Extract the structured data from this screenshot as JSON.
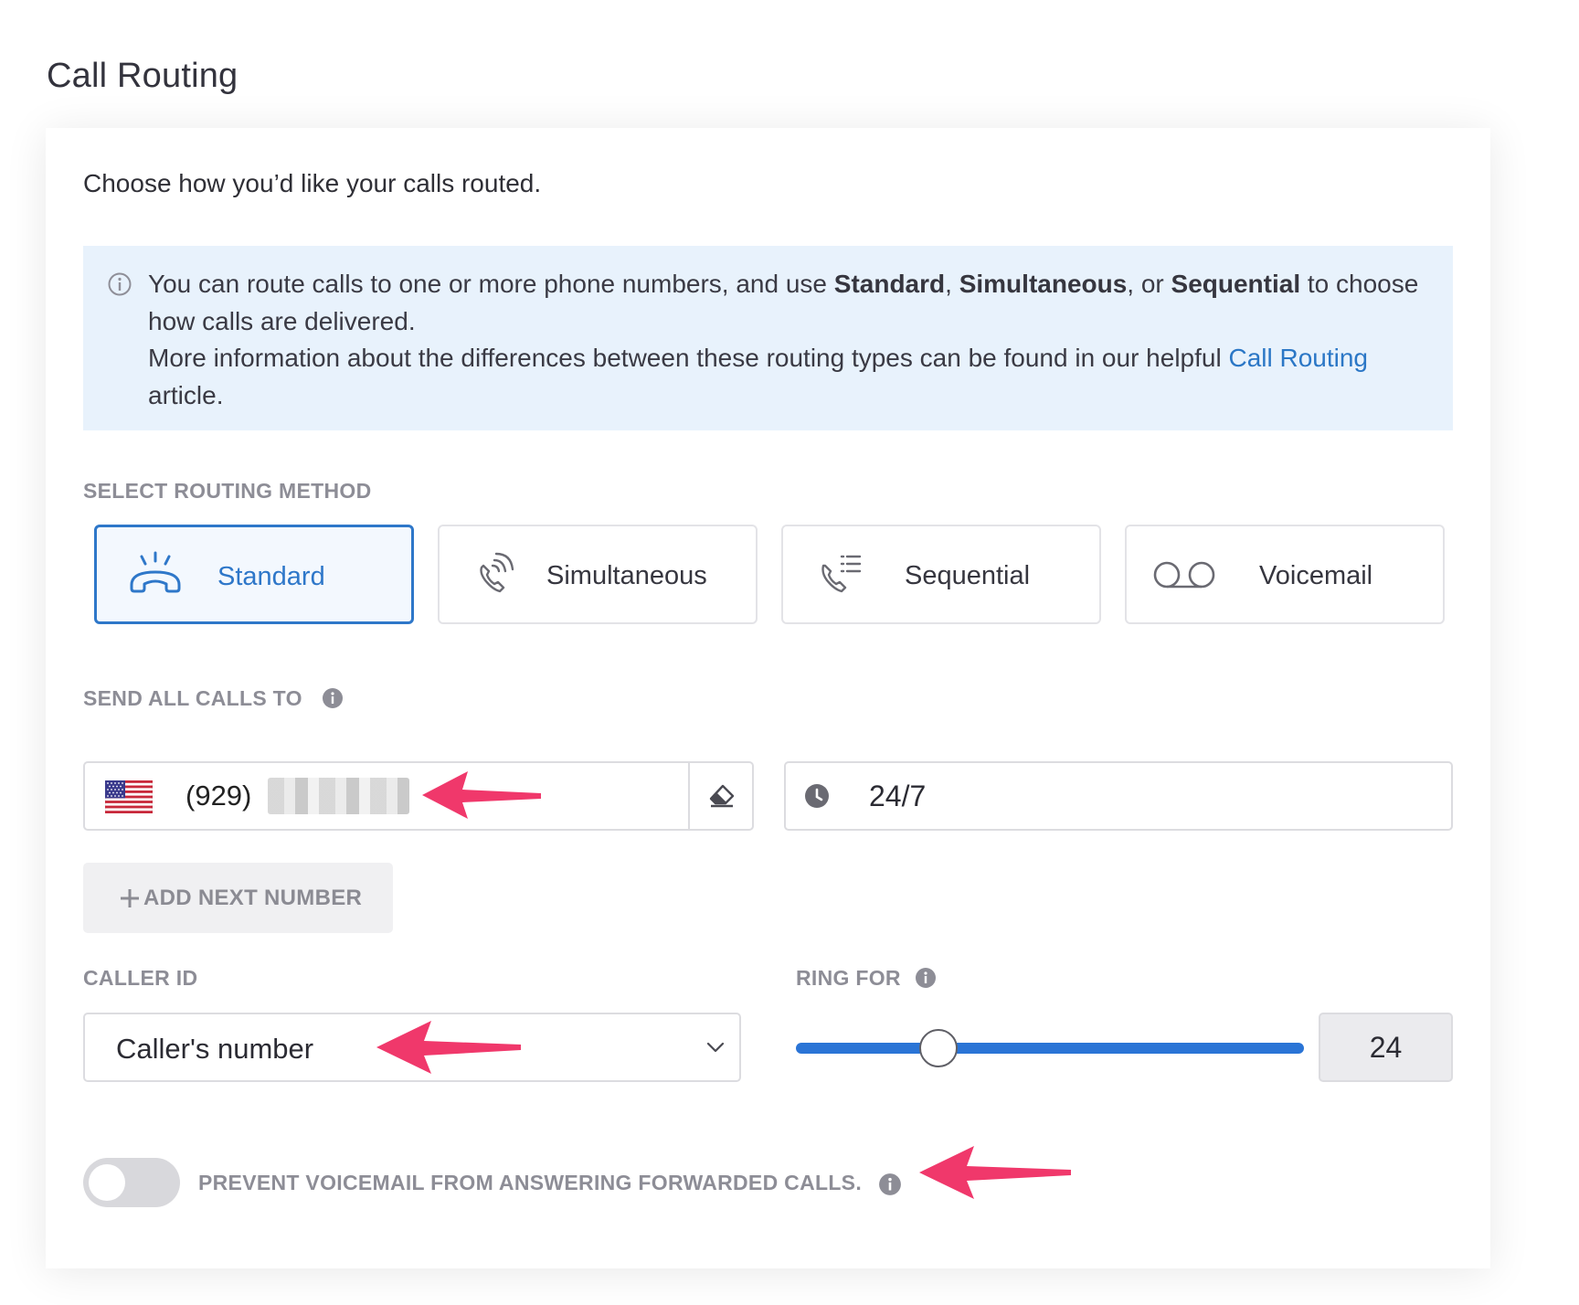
{
  "page": {
    "title": "Call Routing"
  },
  "card": {
    "intro": "Choose how you’d like your calls routed.",
    "info": {
      "line1_prefix": "You can route calls to one or more phone numbers, and use ",
      "standard": "Standard",
      "comma1": ", ",
      "simultaneous": "Simultaneous",
      "or": ", or ",
      "sequential": "Sequential",
      "line1_suffix": " to choose how calls are delivered.",
      "line2_prefix": "More information about the differences between these routing types can be found in our helpful ",
      "link_text": "Call Routing",
      "line2_suffix": " article."
    }
  },
  "routing": {
    "label": "SELECT ROUTING METHOD",
    "methods": [
      {
        "label": "Standard",
        "icon": "phone-ringing-icon",
        "selected": true
      },
      {
        "label": "Simultaneous",
        "icon": "phone-waves-icon",
        "selected": false
      },
      {
        "label": "Sequential",
        "icon": "phone-list-icon",
        "selected": false
      },
      {
        "label": "Voicemail",
        "icon": "voicemail-icon",
        "selected": false
      }
    ]
  },
  "send_all": {
    "label": "SEND ALL CALLS TO",
    "phone": {
      "country": "US",
      "value": "(929)"
    },
    "schedule": "24/7",
    "add_button": "ADD NEXT NUMBER"
  },
  "caller_id": {
    "label": "CALLER ID",
    "selected": "Caller's number"
  },
  "ring_for": {
    "label": "RING FOR",
    "value": "24",
    "fraction": 0.28
  },
  "prevent_voicemail": {
    "label": "PREVENT VOICEMAIL FROM ANSWERING FORWARDED CALLS.",
    "enabled": false
  },
  "colors": {
    "accent": "#2e77c9",
    "annotation_arrow": "#f0386b",
    "info_bg": "#e8f2fc"
  }
}
